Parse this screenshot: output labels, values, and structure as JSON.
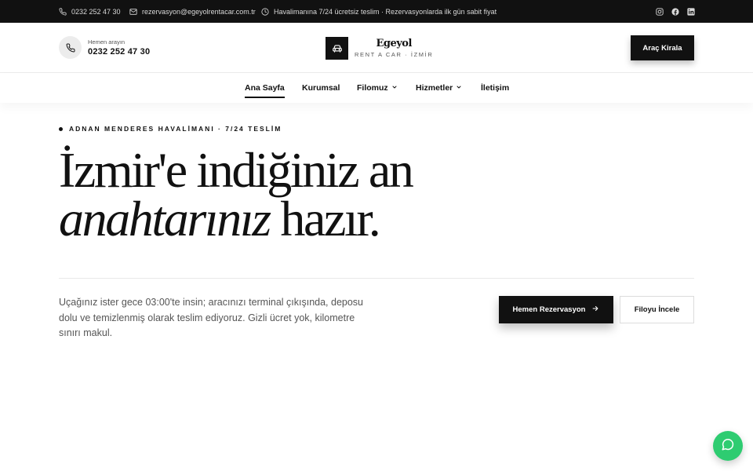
{
  "topbar": {
    "phone": "0232 252 47 30",
    "email": "rezervasyon@egeyolrentacar.com.tr",
    "info": "Havalimanına 7/24 ücretsiz teslim · Rezervasyonlarda ilk gün sabit fiyat",
    "social": [
      "instagram-icon",
      "facebook-icon",
      "linkedin-icon"
    ]
  },
  "header": {
    "call_label": "Hemen arayın",
    "call_number": "0232 252 47 30",
    "brand_name": "Egeyol",
    "brand_sub": "RENT A CAR · İZMİR",
    "cta": "Araç Kirala"
  },
  "nav": {
    "items": [
      {
        "label": "Ana Sayfa",
        "active": true
      },
      {
        "label": "Kurumsal"
      },
      {
        "label": "Filomuz",
        "dropdown": true
      },
      {
        "label": "Hizmetler",
        "dropdown": true
      },
      {
        "label": "İletişim"
      }
    ]
  },
  "hero": {
    "eyebrow": "ADNAN MENDERES HAVALİMANI · 7/24 TESLİM",
    "headline_line1": "İzmir'e indiğiniz an",
    "headline_em": "anahtarınız",
    "headline_rest": " hazır.",
    "lead": "Uçağınız ister gece 03:00'te insin; aracınızı terminal çıkışında, deposu dolu ve temizlenmiş olarak teslim ediyoruz. Gizli ücret yok, kilometre sınırı makul.",
    "primary_cta": "Hemen Rezervasyon",
    "secondary_cta": "Filoyu İncele"
  },
  "colors": {
    "dark": "#111111",
    "chat": "#2ecc71"
  }
}
